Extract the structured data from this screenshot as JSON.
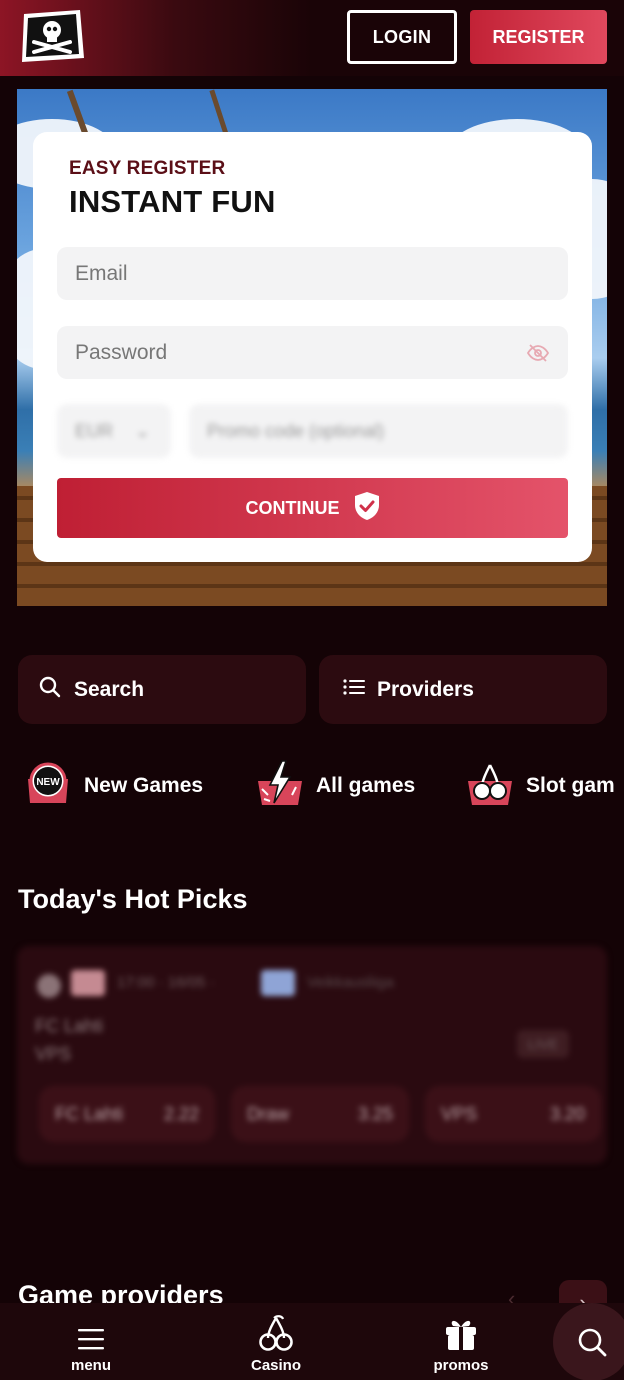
{
  "header": {
    "login_label": "LOGIN",
    "register_label": "REGISTER"
  },
  "register_card": {
    "eyebrow": "EASY REGISTER",
    "title": "INSTANT FUN",
    "email_placeholder": "Email",
    "password_placeholder": "Password",
    "currency_value": "EUR",
    "promo_placeholder": "Promo code (optional)",
    "continue_label": "CONTINUE"
  },
  "quick_actions": {
    "search_label": "Search",
    "providers_label": "Providers"
  },
  "categories": [
    {
      "label": "New Games",
      "badge": "NEW",
      "icon": "new-badge-icon"
    },
    {
      "label": "All games",
      "icon": "lightning-icon"
    },
    {
      "label": "Slot gam",
      "icon": "cherries-icon"
    }
  ],
  "hot_picks": {
    "title": "Today's Hot Picks",
    "odds": [
      {
        "name": "FC Lahti",
        "value": "2.22"
      },
      {
        "name": "Draw",
        "value": "3.25"
      },
      {
        "name": "VPS",
        "value": "3.20"
      }
    ],
    "team_home": "FC Lahti",
    "team_away": "VPS",
    "live_label": "LIVE",
    "meta": "17:00 · 16/05 ·",
    "league": "Veikkausliiga"
  },
  "game_providers": {
    "title": "Game providers",
    "prev_icon": "chevron-left-icon",
    "next_icon": "chevron-right-icon"
  },
  "bottom_nav": {
    "menu_label": "menu",
    "casino_label": "Casino",
    "promos_label": "promos"
  },
  "colors": {
    "background": "#140306",
    "accent": "#c22236",
    "card_dark": "#2c0b10"
  }
}
